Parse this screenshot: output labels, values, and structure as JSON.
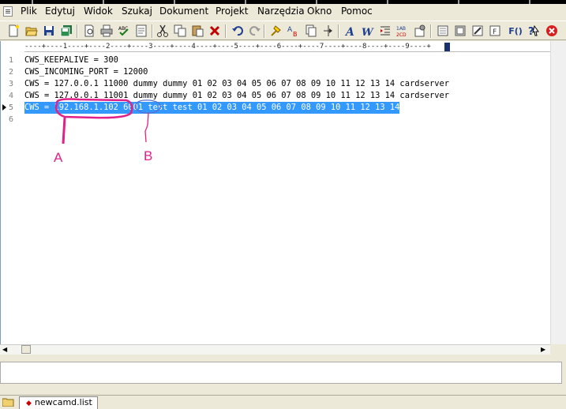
{
  "menu": {
    "items": [
      "Plik",
      "Edytuj",
      "Widok",
      "Szukaj",
      "Dokument",
      "Projekt",
      "Narzędzia",
      "Okno",
      "Pomoc"
    ]
  },
  "toolbar": {
    "buttons": [
      "new-file-icon",
      "open-folder-icon",
      "save-icon",
      "save-all-icon",
      "print-preview-icon",
      "print-icon",
      "spellcheck-icon",
      "properties-icon",
      "cut-icon",
      "copy-icon",
      "paste-icon",
      "delete-icon",
      "undo-icon",
      "redo-icon",
      "find-icon",
      "replace-icon",
      "replace-in-files-icon",
      "goto-line-icon",
      "font-icon",
      "word-wrap-icon",
      "indent-icon",
      "sort-icon",
      "settings-icon",
      "view-1-icon",
      "view-2-icon",
      "view-3-icon",
      "view-4-icon",
      "function-list-icon",
      "help-icon",
      "close-icon"
    ],
    "function_label": "F()"
  },
  "ruler": {
    "text": "----+----1----+----2----+----3----+----4----+----5----+----6----+----7----+----8----+----9----+"
  },
  "editor": {
    "lines": [
      {
        "number": "1",
        "text": "CWS_KEEPALIVE = 300"
      },
      {
        "number": "2",
        "text": "CWS_INCOMING_PORT = 12000"
      },
      {
        "number": "3",
        "text": "CWS = 127.0.0.1 11000 dummy dummy 01 02 03 04 05 06 07 08 09 10 11 12 13 14 cardserver"
      },
      {
        "number": "4",
        "text": "CWS = 127.0.0.1 11001 dummy dummy 01 02 03 04 05 06 07 08 09 10 11 12 13 14 cardserver"
      },
      {
        "number": "5",
        "text": "CWS = 192.168.1.102 6001 test test 01 02 03 04 05 06 07 08 09 10 11 12 13 14"
      },
      {
        "number": "6",
        "text": ""
      }
    ],
    "selected_line": 5
  },
  "annotations": {
    "label_a": "A",
    "label_b": "B",
    "color": "#e0218a"
  },
  "tabs": {
    "active": "newcamd.list"
  }
}
